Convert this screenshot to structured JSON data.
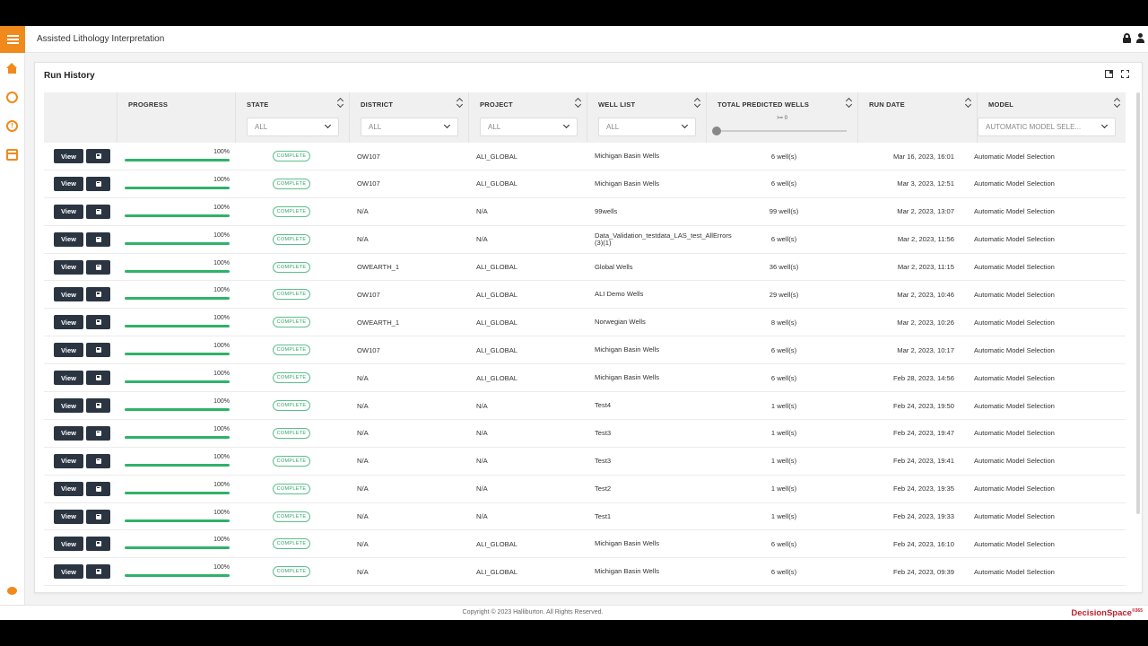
{
  "app": {
    "title": "Assisted Lithology Interpretation"
  },
  "panel": {
    "title": "Run History"
  },
  "columns": {
    "progress": "PROGRESS",
    "state": "STATE",
    "district": "DISTRICT",
    "project": "PROJECT",
    "well_list": "WELL LIST",
    "total": "TOTAL PREDICTED WELLS",
    "run_date": "RUN DATE",
    "model": "MODEL"
  },
  "filters": {
    "state": "ALL",
    "district": "ALL",
    "project": "ALL",
    "well_list": "ALL",
    "total_label": ">= 0",
    "total_min": 0,
    "model": "AUTOMATIC MODEL SELE..."
  },
  "buttons": {
    "view": "View"
  },
  "rows": [
    {
      "progress": "100%",
      "state": "COMPLETE",
      "district": "OW107",
      "project": "ALI_GLOBAL",
      "wells": "Michigan Basin Wells",
      "total": "6 well(s)",
      "date": "Mar 16, 2023, 16:01",
      "model": "Automatic Model Selection"
    },
    {
      "progress": "100%",
      "state": "COMPLETE",
      "district": "OW107",
      "project": "ALI_GLOBAL",
      "wells": "Michigan Basin Wells",
      "total": "6 well(s)",
      "date": "Mar 3, 2023, 12:51",
      "model": "Automatic Model Selection"
    },
    {
      "progress": "100%",
      "state": "COMPLETE",
      "district": "N/A",
      "project": "N/A",
      "wells": "99wells",
      "total": "99 well(s)",
      "date": "Mar 2, 2023, 13:07",
      "model": "Automatic Model Selection"
    },
    {
      "progress": "100%",
      "state": "COMPLETE",
      "district": "N/A",
      "project": "N/A",
      "wells": "Data_Validation_testdata_LAS_test_AllErrors (3)(1)",
      "total": "6 well(s)",
      "date": "Mar 2, 2023, 11:56",
      "model": "Automatic Model Selection"
    },
    {
      "progress": "100%",
      "state": "COMPLETE",
      "district": "OWEARTH_1",
      "project": "ALI_GLOBAL",
      "wells": "Global Wells",
      "total": "36 well(s)",
      "date": "Mar 2, 2023, 11:15",
      "model": "Automatic Model Selection"
    },
    {
      "progress": "100%",
      "state": "COMPLETE",
      "district": "OW107",
      "project": "ALI_GLOBAL",
      "wells": "ALI Demo Wells",
      "total": "29 well(s)",
      "date": "Mar 2, 2023, 10:46",
      "model": "Automatic Model Selection"
    },
    {
      "progress": "100%",
      "state": "COMPLETE",
      "district": "OWEARTH_1",
      "project": "ALI_GLOBAL",
      "wells": "Norwegian Wells",
      "total": "8 well(s)",
      "date": "Mar 2, 2023, 10:26",
      "model": "Automatic Model Selection"
    },
    {
      "progress": "100%",
      "state": "COMPLETE",
      "district": "OW107",
      "project": "ALI_GLOBAL",
      "wells": "Michigan Basin Wells",
      "total": "6 well(s)",
      "date": "Mar 2, 2023, 10:17",
      "model": "Automatic Model Selection"
    },
    {
      "progress": "100%",
      "state": "COMPLETE",
      "district": "N/A",
      "project": "ALI_GLOBAL",
      "wells": "Michigan Basin Wells",
      "total": "6 well(s)",
      "date": "Feb 28, 2023, 14:56",
      "model": "Automatic Model Selection"
    },
    {
      "progress": "100%",
      "state": "COMPLETE",
      "district": "N/A",
      "project": "N/A",
      "wells": "Test4",
      "total": "1 well(s)",
      "date": "Feb 24, 2023, 19:50",
      "model": "Automatic Model Selection"
    },
    {
      "progress": "100%",
      "state": "COMPLETE",
      "district": "N/A",
      "project": "N/A",
      "wells": "Test3",
      "total": "1 well(s)",
      "date": "Feb 24, 2023, 19:47",
      "model": "Automatic Model Selection"
    },
    {
      "progress": "100%",
      "state": "COMPLETE",
      "district": "N/A",
      "project": "N/A",
      "wells": "Test3",
      "total": "1 well(s)",
      "date": "Feb 24, 2023, 19:41",
      "model": "Automatic Model Selection"
    },
    {
      "progress": "100%",
      "state": "COMPLETE",
      "district": "N/A",
      "project": "N/A",
      "wells": "Test2",
      "total": "1 well(s)",
      "date": "Feb 24, 2023, 19:35",
      "model": "Automatic Model Selection"
    },
    {
      "progress": "100%",
      "state": "COMPLETE",
      "district": "N/A",
      "project": "N/A",
      "wells": "Test1",
      "total": "1 well(s)",
      "date": "Feb 24, 2023, 19:33",
      "model": "Automatic Model Selection"
    },
    {
      "progress": "100%",
      "state": "COMPLETE",
      "district": "N/A",
      "project": "ALI_GLOBAL",
      "wells": "Michigan Basin Wells",
      "total": "6 well(s)",
      "date": "Feb 24, 2023, 16:10",
      "model": "Automatic Model Selection"
    },
    {
      "progress": "100%",
      "state": "COMPLETE",
      "district": "N/A",
      "project": "ALI_GLOBAL",
      "wells": "Michigan Basin Wells",
      "total": "6 well(s)",
      "date": "Feb 24, 2023, 09:39",
      "model": "Automatic Model Selection"
    }
  ],
  "footer": {
    "copyright": "Copyright © 2023 Halliburton. All Rights Reserved.",
    "brand": "DecisionSpace",
    "brand_suffix": "®365"
  },
  "colors": {
    "accent": "#f08a1c",
    "button": "#2b3542",
    "progress": "#2fb26a",
    "brand": "#c0202e"
  },
  "icons": [
    "menu-icon",
    "lock-icon",
    "user-icon",
    "home-icon",
    "gauge-icon",
    "alert-icon",
    "window-icon",
    "chat-icon",
    "export-icon",
    "expand-icon",
    "sort-icon",
    "chevron-down-icon",
    "save-icon"
  ]
}
